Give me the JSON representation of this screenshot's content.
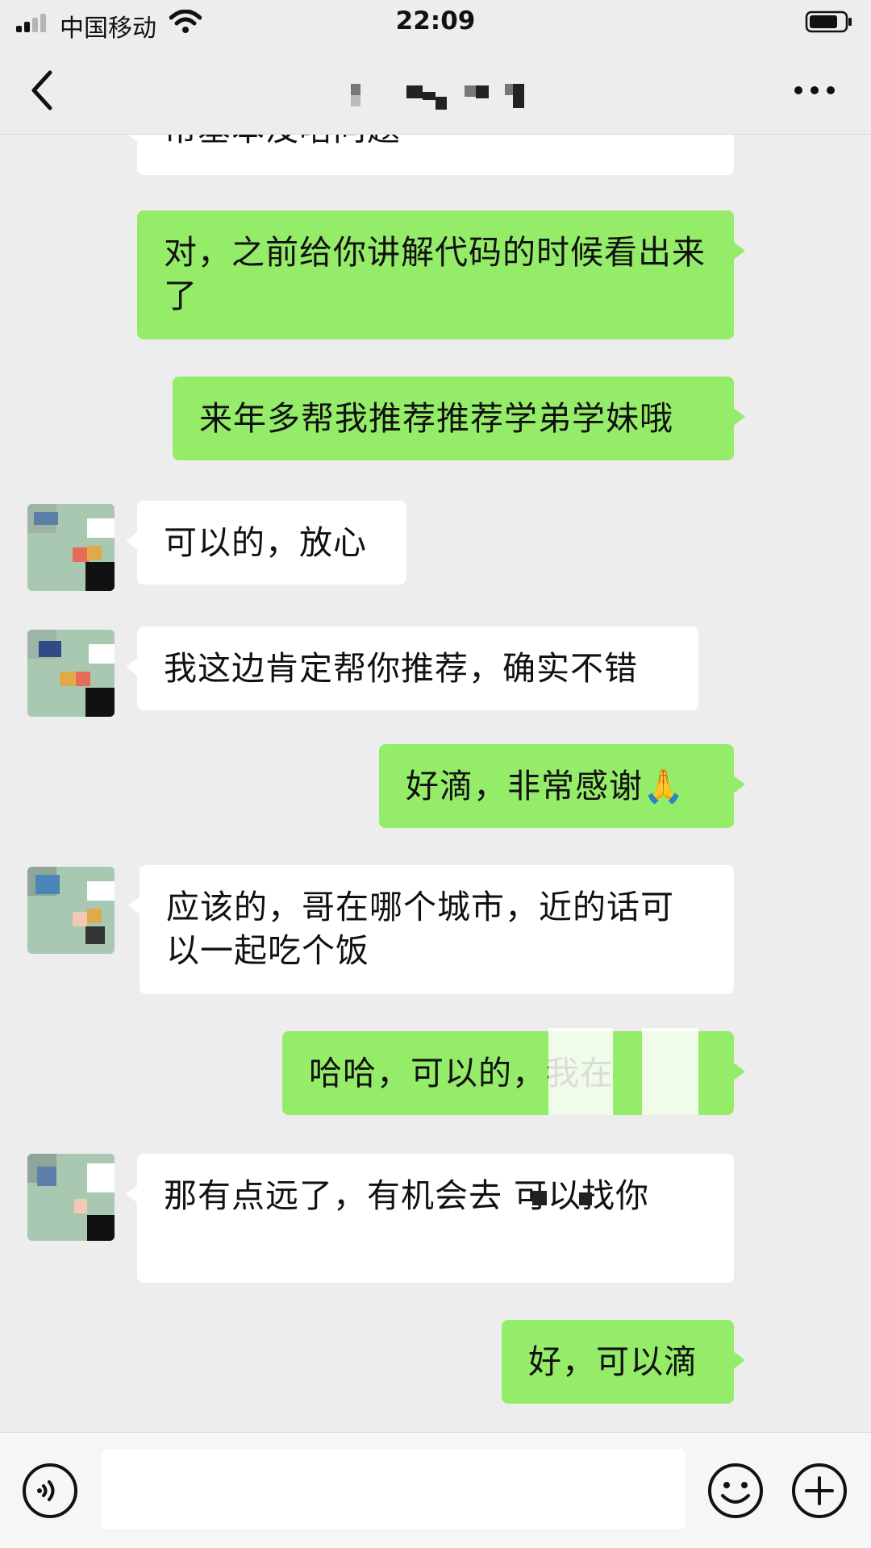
{
  "status_bar": {
    "carrier": "中国移动",
    "time": "22:09"
  },
  "nav": {
    "back_icon": "chevron-left-icon",
    "more_icon": "more-dots-icon"
  },
  "messages": [
    {
      "side": "them",
      "text": "帮基本没啥问题"
    },
    {
      "side": "me",
      "text": "对，之前给你讲解代码的时候看出来了"
    },
    {
      "side": "me",
      "text": "来年多帮我推荐推荐学弟学妹哦"
    },
    {
      "side": "them",
      "text": "可以的，放心"
    },
    {
      "side": "them",
      "text": "我这边肯定帮你推荐，确实不错"
    },
    {
      "side": "me",
      "text": "好滴，非常感谢🙏"
    },
    {
      "side": "them",
      "text": "应该的，哥在哪个城市，近的话可以一起吃个饭"
    },
    {
      "side": "me",
      "text": "哈哈，可以的，我在"
    },
    {
      "side": "them",
      "text": "那有点远了，有机会去 可以找你"
    },
    {
      "side": "me",
      "text": "好，可以滴"
    }
  ],
  "input": {
    "voice_icon": "voice-icon",
    "emoji_icon": "emoji-icon",
    "plus_icon": "plus-icon",
    "value": ""
  },
  "colors": {
    "background": "#ededed",
    "my_bubble": "#95ec69",
    "their_bubble": "#ffffff"
  }
}
